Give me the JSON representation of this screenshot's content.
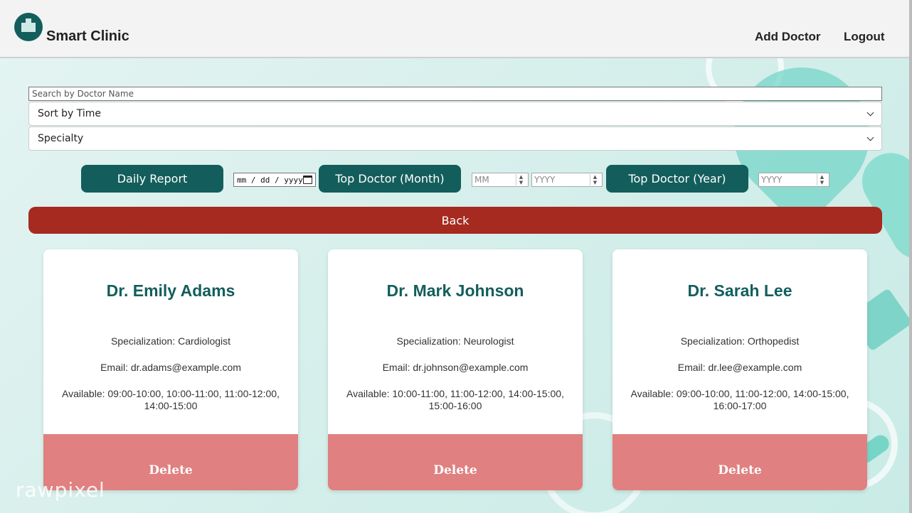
{
  "header": {
    "brand": "Smart Clinic",
    "nav": {
      "add_doctor": "Add Doctor",
      "logout": "Logout"
    }
  },
  "filters": {
    "search_placeholder": "Search by Doctor Name",
    "sort_selected": "Sort by Time",
    "specialty_selected": "Specialty"
  },
  "actions": {
    "daily_report": "Daily Report",
    "date_placeholder": "mm / dd / yyyy",
    "top_doctor_month": "Top Doctor (Month)",
    "month_placeholder": "MM",
    "month_year_placeholder": "YYYY",
    "top_doctor_year": "Top Doctor (Year)",
    "year_placeholder": "YYYY",
    "back": "Back"
  },
  "doctors": [
    {
      "name": "Dr. Emily Adams",
      "specialization": "Specialization: Cardiologist",
      "email": "Email: dr.adams@example.com",
      "available": "Available: 09:00-10:00, 10:00-11:00, 11:00-12:00, 14:00-15:00",
      "delete_label": "Delete"
    },
    {
      "name": "Dr. Mark Johnson",
      "specialization": "Specialization: Neurologist",
      "email": "Email: dr.johnson@example.com",
      "available": "Available: 10:00-11:00, 11:00-12:00, 14:00-15:00, 15:00-16:00",
      "delete_label": "Delete"
    },
    {
      "name": "Dr. Sarah Lee",
      "specialization": "Specialization: Orthopedist",
      "email": "Email: dr.lee@example.com",
      "available": "Available: 09:00-10:00, 11:00-12:00, 14:00-15:00, 16:00-17:00",
      "delete_label": "Delete"
    }
  ],
  "watermark": "rawpixel",
  "colors": {
    "primary": "#135e5c",
    "danger": "#a62a1f",
    "delete": "#e08080",
    "background": "#d6efec"
  }
}
